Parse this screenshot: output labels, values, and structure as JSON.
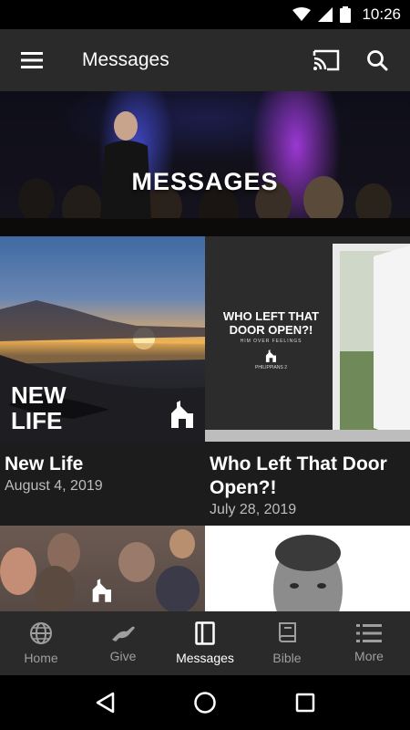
{
  "status_bar": {
    "time": "10:26"
  },
  "app_bar": {
    "title": "Messages"
  },
  "hero": {
    "title": "MESSAGES"
  },
  "thumbnails": {
    "new_life_art": "NEW LIFE",
    "door_art_title": "WHO LEFT THAT DOOR OPEN?!",
    "door_art_sub": "HIM OVER FEELINGS",
    "door_art_ref": "PHILIPPIANS 2"
  },
  "messages": [
    {
      "title": "New Life",
      "date": "August 4, 2019"
    },
    {
      "title": "Who Left That Door Open?!",
      "date": "July 28, 2019"
    }
  ],
  "bottom_nav": [
    {
      "label": "Home",
      "icon": "globe-icon",
      "active": false
    },
    {
      "label": "Give",
      "icon": "give-hand-icon",
      "active": false
    },
    {
      "label": "Messages",
      "icon": "messages-icon",
      "active": true
    },
    {
      "label": "Bible",
      "icon": "book-icon",
      "active": false
    },
    {
      "label": "More",
      "icon": "list-icon",
      "active": false
    }
  ],
  "colors": {
    "app_bar": "#2a2a2a",
    "background": "#1c1c1c",
    "inactive_nav": "#9e9e9e",
    "active_nav": "#ffffff"
  }
}
